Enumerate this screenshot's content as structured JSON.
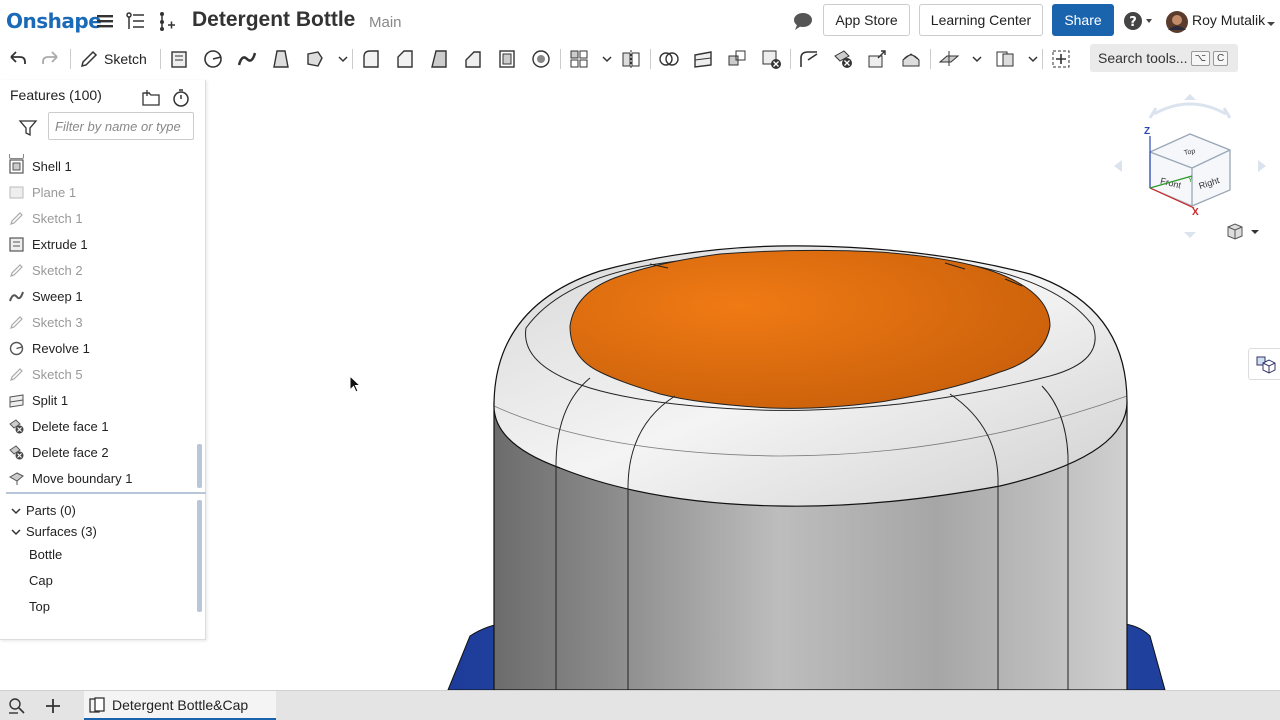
{
  "header": {
    "logo": "Onshape",
    "doc_title": "Detergent Bottle",
    "doc_branch": "Main",
    "app_store": "App Store",
    "learning_center": "Learning Center",
    "share": "Share",
    "user_name": "Roy Mutalik",
    "icons": [
      "menu-icon",
      "versions-icon",
      "branch-icon",
      "comment-icon",
      "help-icon",
      "avatar"
    ]
  },
  "toolbar": {
    "sketch_label": "Sketch",
    "search_tools_label": "Search tools...",
    "search_shortcut": [
      "⌥",
      "C"
    ]
  },
  "feature_panel": {
    "title": "Features (100)",
    "filter_placeholder": "Filter by name or type",
    "features": [
      {
        "name": "Shell 1",
        "icon": "shell-icon",
        "dim": false
      },
      {
        "name": "Plane 1",
        "icon": "plane-icon",
        "dim": true
      },
      {
        "name": "Sketch 1",
        "icon": "sketch-icon",
        "dim": true
      },
      {
        "name": "Extrude 1",
        "icon": "extrude-icon",
        "dim": false
      },
      {
        "name": "Sketch 2",
        "icon": "sketch-icon",
        "dim": true
      },
      {
        "name": "Sweep 1",
        "icon": "sweep-icon",
        "dim": false
      },
      {
        "name": "Sketch 3",
        "icon": "sketch-icon",
        "dim": true
      },
      {
        "name": "Revolve 1",
        "icon": "revolve-icon",
        "dim": false
      },
      {
        "name": "Sketch 5",
        "icon": "sketch-icon",
        "dim": true
      },
      {
        "name": "Split 1",
        "icon": "split-icon",
        "dim": false
      },
      {
        "name": "Delete face 1",
        "icon": "delete-face-icon",
        "dim": false
      },
      {
        "name": "Delete face 2",
        "icon": "delete-face-icon",
        "dim": false
      },
      {
        "name": "Move boundary 1",
        "icon": "move-boundary-icon",
        "dim": false
      }
    ],
    "parts_label": "Parts (0)",
    "surfaces_label": "Surfaces (3)",
    "surfaces": [
      "Bottle",
      "Cap",
      "Top"
    ]
  },
  "navcube": {
    "top": "Top",
    "front": "Front",
    "right": "Right",
    "axis_z": "Z",
    "axis_x": "X",
    "axis_y": "Y"
  },
  "bottom": {
    "tab_label": "Detergent Bottle&Cap"
  },
  "colors": {
    "brand": "#1a64ad",
    "orange_face": "#e8700f",
    "blue_part": "#2c4aa8",
    "gray_surface": "#c8c8c8"
  }
}
